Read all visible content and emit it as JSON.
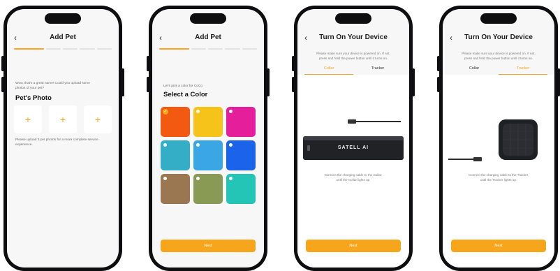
{
  "screen1": {
    "title": "Add Pet",
    "prompt_line1": "Wow, that's a great name! Could you upload some",
    "prompt_line2": "photos of your pet?",
    "heading": "Pet's Photo",
    "add_symbol": "+",
    "note_line1": "Please upload 3 pet photos for a more complete service",
    "note_line2": "experience."
  },
  "screen2": {
    "title": "Add Pet",
    "prompt": "Let's pick a color for CoCo",
    "heading": "Select a Color",
    "colors": [
      "#f25a12",
      "#f5c31a",
      "#e51f9b",
      "#34aec6",
      "#3aa6e3",
      "#1b63e8",
      "#9a7750",
      "#889a54",
      "#24c5b6"
    ],
    "next_label": "Next"
  },
  "screen3": {
    "title": "Turn On Your Device",
    "hint_line1": "Please make sure your device is powered on. If not,",
    "hint_line2": "press and hold the power button until it turns on.",
    "tab_collar": "Collar",
    "tab_tracker": "Tracker",
    "brand": "SATELL AI",
    "caption_line1": "Connect the charging cable to the Collar,",
    "caption_line2": "until the Collar lights up.",
    "next_label": "Next"
  },
  "screen4": {
    "title": "Turn On Your Device",
    "hint_line1": "Please make sure your device is powered on. If not,",
    "hint_line2": "press and hold the power button until it turns on.",
    "tab_collar": "Collar",
    "tab_tracker": "Tracker",
    "caption_line1": "Connect the charging cable to the Tracker,",
    "caption_line2": "until the Tracker lights up.",
    "next_label": "Next"
  },
  "colors": {
    "accent": "#f7a51b",
    "phone_frame": "#0e0e10",
    "screen_bg": "#f7f7f7"
  }
}
